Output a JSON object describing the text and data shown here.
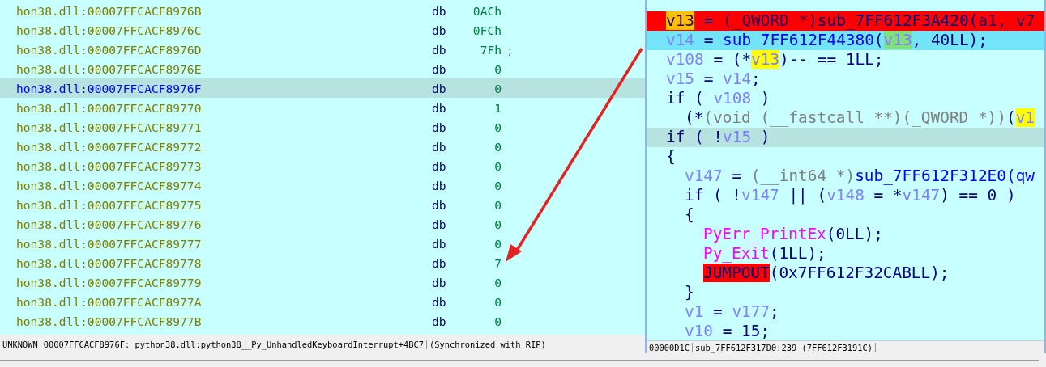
{
  "disasm": {
    "rows": [
      {
        "address": "hon38.dll:00007FFCACF8976B",
        "op": "db",
        "value": "0ACh",
        "selected": false
      },
      {
        "address": "hon38.dll:00007FFCACF8976C",
        "op": "db",
        "value": "0FCh",
        "selected": false
      },
      {
        "address": "hon38.dll:00007FFCACF8976D",
        "op": "db",
        "value": "7Fh",
        "comment": ";",
        "selected": false
      },
      {
        "address": "hon38.dll:00007FFCACF8976E",
        "op": "db",
        "value": "0",
        "selected": false
      },
      {
        "address": "hon38.dll:00007FFCACF8976F",
        "op": "db",
        "value": "0",
        "selected": true
      },
      {
        "address": "hon38.dll:00007FFCACF89770",
        "op": "db",
        "value": "1",
        "selected": false
      },
      {
        "address": "hon38.dll:00007FFCACF89771",
        "op": "db",
        "value": "0",
        "selected": false
      },
      {
        "address": "hon38.dll:00007FFCACF89772",
        "op": "db",
        "value": "0",
        "selected": false
      },
      {
        "address": "hon38.dll:00007FFCACF89773",
        "op": "db",
        "value": "0",
        "selected": false
      },
      {
        "address": "hon38.dll:00007FFCACF89774",
        "op": "db",
        "value": "0",
        "selected": false
      },
      {
        "address": "hon38.dll:00007FFCACF89775",
        "op": "db",
        "value": "0",
        "selected": false
      },
      {
        "address": "hon38.dll:00007FFCACF89776",
        "op": "db",
        "value": "0",
        "selected": false
      },
      {
        "address": "hon38.dll:00007FFCACF89777",
        "op": "db",
        "value": "0",
        "selected": false
      },
      {
        "address": "hon38.dll:00007FFCACF89778",
        "op": "db",
        "value": "7",
        "selected": false
      },
      {
        "address": "hon38.dll:00007FFCACF89779",
        "op": "db",
        "value": "0",
        "selected": false
      },
      {
        "address": "hon38.dll:00007FFCACF8977A",
        "op": "db",
        "value": "0",
        "selected": false
      },
      {
        "address": "hon38.dll:00007FFCACF8977B",
        "op": "db",
        "value": "0",
        "selected": false
      }
    ],
    "status": {
      "segment": "UNKNOWN",
      "location": "00007FFCACF8976F: python38.dll:python38__Py_UnhandledKeyboardInterrupt+4BC7",
      "sync": "(Synchronized with RIP)"
    }
  },
  "pseudocode": {
    "lines": [
      {
        "kind": "breakpoint",
        "tokens": [
          {
            "text": "v13",
            "kind": "var",
            "color": "#ffc000"
          },
          {
            "text": " = ",
            "kind": "op"
          },
          {
            "text": "(_QWORD *)",
            "kind": "cast"
          },
          {
            "text": "sub_7FF612F3A420",
            "kind": "func"
          },
          {
            "text": "(",
            "kind": "op"
          },
          {
            "text": "a1",
            "kind": "var"
          },
          {
            "text": ", ",
            "kind": "op"
          },
          {
            "text": "v7",
            "kind": "var"
          }
        ]
      },
      {
        "kind": "current",
        "tokens": [
          {
            "text": "v14",
            "kind": "var"
          },
          {
            "text": " = ",
            "kind": "op"
          },
          {
            "text": "sub_7FF612F44380",
            "kind": "func"
          },
          {
            "text": "(",
            "kind": "op"
          },
          {
            "text": "v13",
            "kind": "var",
            "color": "#80e080"
          },
          {
            "text": ", 40LL);",
            "kind": "op"
          }
        ]
      },
      {
        "tokens": [
          {
            "text": "v108",
            "kind": "var"
          },
          {
            "text": " = (*",
            "kind": "op"
          },
          {
            "text": "v13",
            "kind": "var",
            "color": "#ffff00"
          },
          {
            "text": ")-- == 1LL;",
            "kind": "op"
          }
        ]
      },
      {
        "tokens": [
          {
            "text": "v15",
            "kind": "var"
          },
          {
            "text": " = ",
            "kind": "op"
          },
          {
            "text": "v14",
            "kind": "var"
          },
          {
            "text": ";",
            "kind": "op"
          }
        ]
      },
      {
        "tokens": [
          {
            "text": "if ( ",
            "kind": "op"
          },
          {
            "text": "v108",
            "kind": "var"
          },
          {
            "text": " )",
            "kind": "op"
          }
        ],
        "children": [
          {
            "tokens": [
              {
                "text": "(*",
                "kind": "op"
              },
              {
                "text": "(void (__fastcall **)(_QWORD *))",
                "kind": "cast"
              },
              {
                "text": "(",
                "kind": "op"
              },
              {
                "text": "v1",
                "kind": "var",
                "color": "#ffff00"
              }
            ]
          }
        ]
      },
      {
        "kind": "cursor",
        "tokens": [
          {
            "text": "if ( !",
            "kind": "op"
          },
          {
            "text": "v15",
            "kind": "var"
          },
          {
            "text": " )",
            "kind": "op"
          }
        ]
      },
      {
        "tokens": [
          {
            "text": "{",
            "kind": "op"
          }
        ],
        "children": [
          {
            "tokens": [
              {
                "text": "v147",
                "kind": "var"
              },
              {
                "text": " = ",
                "kind": "op"
              },
              {
                "text": "(__int64 *)",
                "kind": "cast"
              },
              {
                "text": "sub_7FF612F312E0",
                "kind": "func"
              },
              {
                "text": "(qw",
                "kind": "func"
              }
            ]
          },
          {
            "tokens": [
              {
                "text": "if ( !",
                "kind": "op"
              },
              {
                "text": "v147",
                "kind": "var"
              },
              {
                "text": " || (",
                "kind": "op"
              },
              {
                "text": "v148",
                "kind": "var"
              },
              {
                "text": " = *",
                "kind": "op"
              },
              {
                "text": "v147",
                "kind": "var"
              },
              {
                "text": ") == 0 )",
                "kind": "op"
              }
            ]
          },
          {
            "tokens": [
              {
                "text": "{",
                "kind": "op"
              }
            ],
            "children": [
              {
                "tokens": [
                  {
                    "text": "PyErr_PrintEx",
                    "kind": "import"
                  },
                  {
                    "text": "(0LL);",
                    "kind": "op"
                  }
                ]
              },
              {
                "tokens": [
                  {
                    "text": "Py_Exit",
                    "kind": "import"
                  },
                  {
                    "text": "(1LL);",
                    "kind": "op"
                  }
                ]
              },
              {
                "tokens": [
                  {
                    "text": "JUMPOUT",
                    "kind": "op",
                    "color": "#ff0000"
                  },
                  {
                    "text": "(0x7FF612F32CABLL);",
                    "kind": "op"
                  }
                ]
              }
            ]
          },
          {
            "tokens": [
              {
                "text": "}",
                "kind": "op"
              }
            ]
          },
          {
            "tokens": [
              {
                "text": "v1",
                "kind": "var"
              },
              {
                "text": " = ",
                "kind": "op"
              },
              {
                "text": "v177",
                "kind": "var"
              },
              {
                "text": ";",
                "kind": "op"
              }
            ]
          },
          {
            "tokens": [
              {
                "text": "v10",
                "kind": "var"
              },
              {
                "text": " = 15;",
                "kind": "op"
              }
            ]
          }
        ]
      }
    ],
    "status": {
      "offset": "00000D1C",
      "location": "sub_7FF612F317D0:239 (7FF612F3191C)"
    }
  }
}
